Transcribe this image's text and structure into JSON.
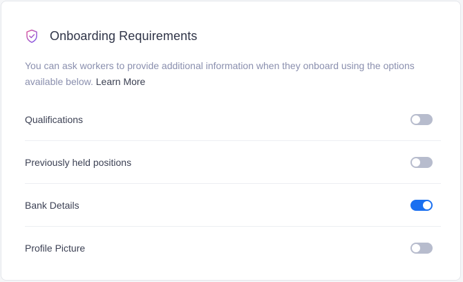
{
  "header": {
    "icon": "shield-check-icon",
    "title": "Onboarding Requirements"
  },
  "description": {
    "text": "You can ask workers to provide additional information when they onboard using the options available below.",
    "link": "Learn More"
  },
  "requirements": [
    {
      "label": "Qualifications",
      "enabled": false
    },
    {
      "label": "Previously held positions",
      "enabled": false
    },
    {
      "label": "Bank Details",
      "enabled": true
    },
    {
      "label": "Profile Picture",
      "enabled": false
    }
  ],
  "colors": {
    "accent": "#1a6ff0",
    "toggle_off": "#b7bccd",
    "icon_gradient_start": "#e05a9a",
    "icon_gradient_end": "#7a5cf0"
  }
}
